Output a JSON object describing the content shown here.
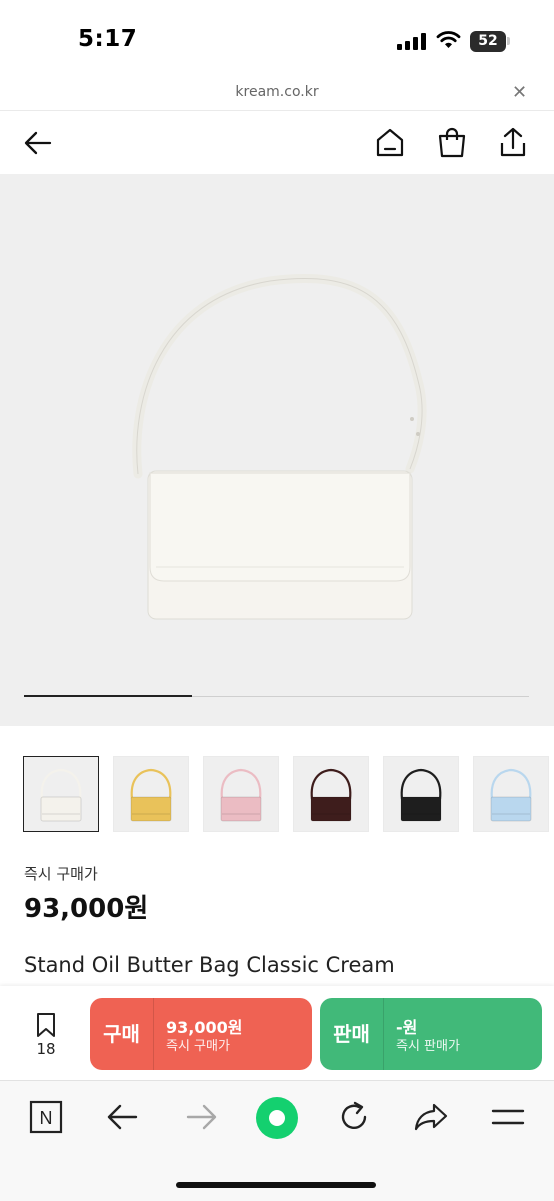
{
  "status_bar": {
    "time": "5:17",
    "battery": "52"
  },
  "browser": {
    "url": "kream.co.kr",
    "close_label": "✕"
  },
  "header": {
    "back_icon": "arrow-left-icon",
    "home_icon": "home-icon",
    "bag_icon": "shopping-bag-icon",
    "share_icon": "share-icon"
  },
  "gallery": {
    "progress_fraction": 0.333,
    "main_color": "#f6f4ef",
    "thumbnails": [
      {
        "color": "#f4f2ec",
        "selected": true
      },
      {
        "color": "#e9c25a",
        "selected": false
      },
      {
        "color": "#ebbcc3",
        "selected": false
      },
      {
        "color": "#3e1d1c",
        "selected": false
      },
      {
        "color": "#1e1e1e",
        "selected": false
      },
      {
        "color": "#b9d7ee",
        "selected": false
      }
    ]
  },
  "product": {
    "price_label": "즉시 구매가",
    "price": "93,000원",
    "name": "Stand Oil Butter Bag Classic Cream"
  },
  "action_bar": {
    "wish_count": "18",
    "buy": {
      "label": "구매",
      "price": "93,000원",
      "sub": "즉시 구매가",
      "color": "#ef6253"
    },
    "sell": {
      "label": "판매",
      "price": "-원",
      "sub": "즉시 판매가",
      "color": "#41b979"
    }
  },
  "toolbar": {
    "icons": [
      "naver-n-icon",
      "back-arrow-icon",
      "forward-arrow-icon",
      "green-dot-home-icon",
      "reload-icon",
      "share-icon",
      "menu-icon"
    ],
    "naver_letter": "N"
  }
}
